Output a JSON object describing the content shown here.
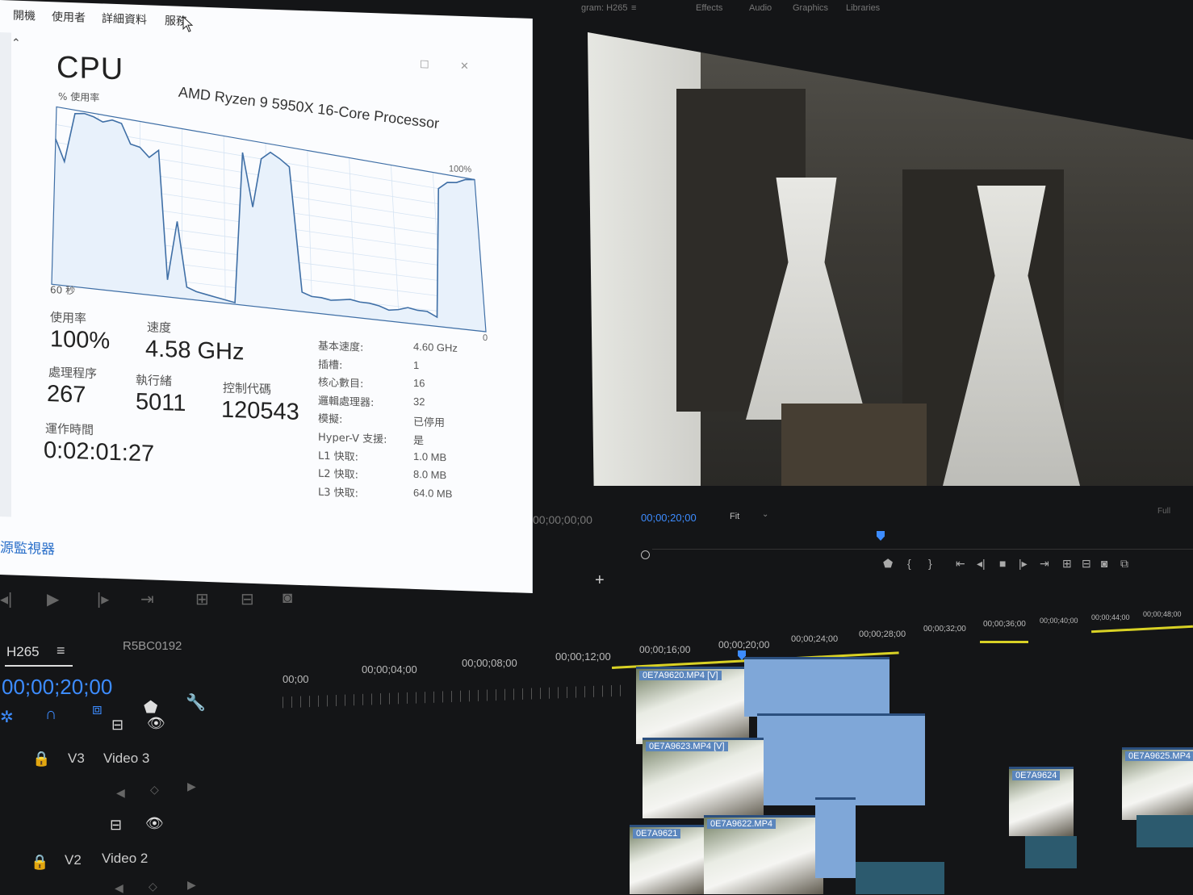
{
  "task_manager": {
    "tabs": [
      "開機",
      "使用者",
      "詳細資料",
      "服務"
    ],
    "title": "CPU",
    "processor": "AMD Ryzen 9 5950X 16-Core Processor",
    "graph": {
      "y_label": "% 使用率",
      "y_max": "100%",
      "y_min": "0",
      "x_label": "60 秒",
      "usage_series": [
        82,
        70,
        98,
        99,
        98,
        96,
        98,
        97,
        86,
        85,
        80,
        85,
        10,
        45,
        7,
        5,
        4,
        3,
        2,
        1,
        92,
        60,
        90,
        95,
        92,
        88,
        12,
        10,
        10,
        9,
        10,
        11,
        10,
        10,
        9,
        7,
        8,
        10,
        9,
        9,
        6,
        90,
        95,
        96,
        99,
        100
      ]
    },
    "stats": [
      {
        "label": "使用率",
        "value": "100%"
      },
      {
        "label": "速度",
        "value": "4.58 GHz"
      },
      {
        "label": "處理程序",
        "value": "267"
      },
      {
        "label": "執行緒",
        "value": "5011"
      },
      {
        "label": "控制代碼",
        "value": "120543"
      },
      {
        "label": "運作時間",
        "value": "0:02:01:27"
      }
    ],
    "details": [
      {
        "key": "基本速度:",
        "value": "4.60 GHz"
      },
      {
        "key": "插槽:",
        "value": "1"
      },
      {
        "key": "核心數目:",
        "value": "16"
      },
      {
        "key": "邏輯處理器:",
        "value": "32"
      },
      {
        "key": "模擬:",
        "value": "已停用"
      },
      {
        "key": "Hyper-V 支援:",
        "value": "是"
      },
      {
        "key": "L1 快取:",
        "value": "1.0 MB"
      },
      {
        "key": "L2 快取:",
        "value": "8.0 MB"
      },
      {
        "key": "L3 快取:",
        "value": "64.0 MB"
      }
    ],
    "footer_link": "源監視器"
  },
  "program_monitor": {
    "title": "gram: H265",
    "panel_tabs": [
      "Effects",
      "Audio",
      "Graphics",
      "Libraries"
    ],
    "timecode": "00;00;20;00",
    "fit": "Fit",
    "full": "Full",
    "source_timecode": "00;00;00;00"
  },
  "timeline": {
    "sequence_tab": "H265",
    "other_tab": "R5BC0192",
    "timecode": "00;00;20;00",
    "ruler": [
      "00;00",
      "00;00;04;00",
      "00;00;08;00",
      "00;00;12;00",
      "00;00;16;00",
      "00;00;20;00",
      "00;00;24;00",
      "00;00;28;00",
      "00;00;32;00",
      "00;00;36;00",
      "00;00;40;00",
      "00;00;44;00",
      "00;00;48;00"
    ],
    "tracks": [
      {
        "id": "V3",
        "name": "Video 3"
      },
      {
        "id": "V2",
        "name": "Video 2"
      }
    ],
    "clips": [
      "0E7A9620.MP4 [V]",
      "0E7A9623.MP4 [V]",
      "0E7A9621",
      "0E7A9622.MP4",
      "0E7A9624",
      "0E7A9625.MP4"
    ]
  },
  "colors": {
    "accent": "#3d8cff",
    "work_area": "#d9d225",
    "clip": "#7fa7d8"
  }
}
